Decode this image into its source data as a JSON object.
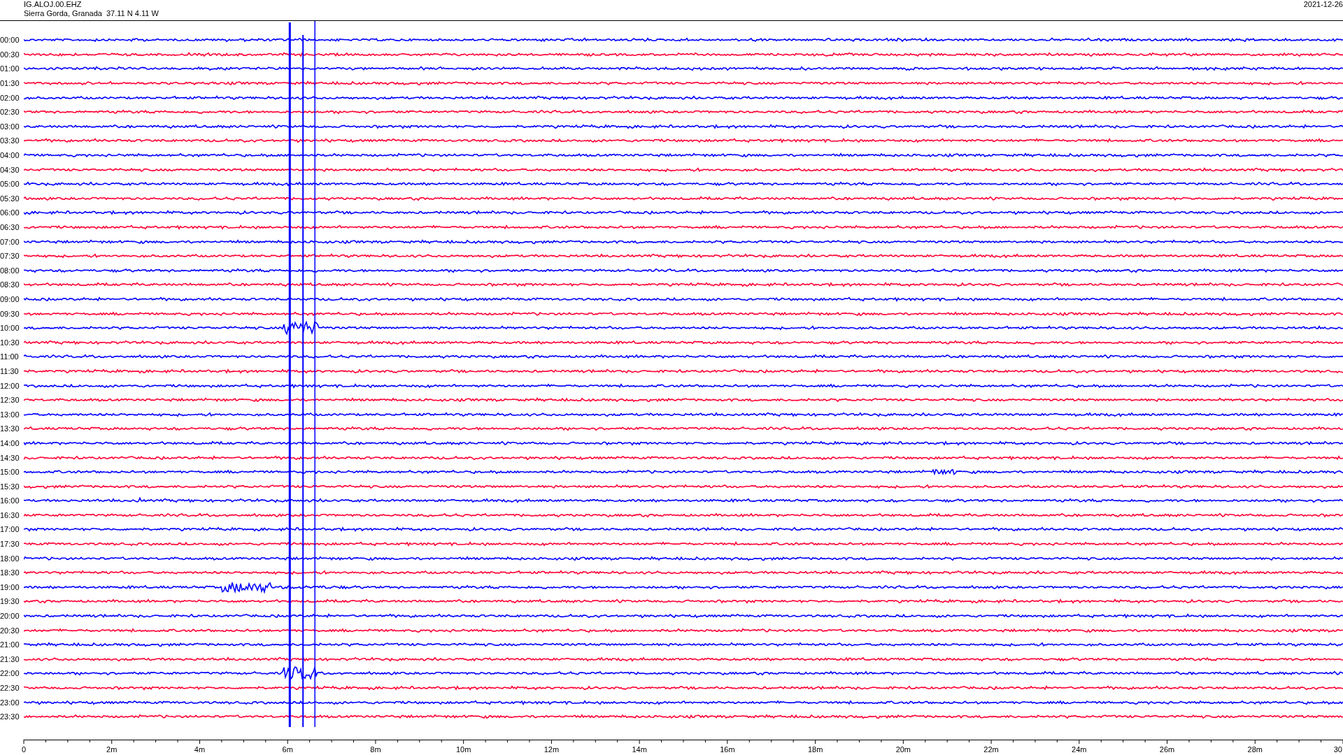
{
  "header": {
    "station": "IG.ALOJ.00.EHZ",
    "location": "Sierra Gorda, Granada  37.11 N 4.11 W",
    "date": "2021-12-26"
  },
  "traces": [
    {
      "time": "00:00",
      "color": "#0000ff"
    },
    {
      "time": "00:30",
      "color": "#ff0033"
    },
    {
      "time": "01:00",
      "color": "#0000ff"
    },
    {
      "time": "01:30",
      "color": "#ff0033"
    },
    {
      "time": "02:00",
      "color": "#0000ff"
    },
    {
      "time": "02:30",
      "color": "#ff0033"
    },
    {
      "time": "03:00",
      "color": "#0000ff"
    },
    {
      "time": "03:30",
      "color": "#ff0033"
    },
    {
      "time": "04:00",
      "color": "#0000ff"
    },
    {
      "time": "04:30",
      "color": "#ff0033"
    },
    {
      "time": "05:00",
      "color": "#0000ff"
    },
    {
      "time": "05:30",
      "color": "#ff0033"
    },
    {
      "time": "06:00",
      "color": "#0000ff"
    },
    {
      "time": "06:30",
      "color": "#ff0033"
    },
    {
      "time": "07:00",
      "color": "#0000ff"
    },
    {
      "time": "07:30",
      "color": "#ff0033"
    },
    {
      "time": "08:00",
      "color": "#0000ff"
    },
    {
      "time": "08:30",
      "color": "#ff0033"
    },
    {
      "time": "09:00",
      "color": "#0000ff"
    },
    {
      "time": "09:30",
      "color": "#ff0033"
    },
    {
      "time": "10:00",
      "color": "#0000ff"
    },
    {
      "time": "10:30",
      "color": "#ff0033"
    },
    {
      "time": "11:00",
      "color": "#0000ff"
    },
    {
      "time": "11:30",
      "color": "#ff0033"
    },
    {
      "time": "12:00",
      "color": "#0000ff"
    },
    {
      "time": "12:30",
      "color": "#ff0033"
    },
    {
      "time": "13:00",
      "color": "#0000ff"
    },
    {
      "time": "13:30",
      "color": "#ff0033"
    },
    {
      "time": "14:00",
      "color": "#0000ff"
    },
    {
      "time": "14:30",
      "color": "#ff0033"
    },
    {
      "time": "15:00",
      "color": "#0000ff"
    },
    {
      "time": "15:30",
      "color": "#ff0033"
    },
    {
      "time": "16:00",
      "color": "#0000ff"
    },
    {
      "time": "16:30",
      "color": "#ff0033"
    },
    {
      "time": "17:00",
      "color": "#0000ff"
    },
    {
      "time": "17:30",
      "color": "#ff0033"
    },
    {
      "time": "18:00",
      "color": "#0000ff"
    },
    {
      "time": "18:30",
      "color": "#ff0033"
    },
    {
      "time": "19:00",
      "color": "#0000ff"
    },
    {
      "time": "19:30",
      "color": "#ff0033"
    },
    {
      "time": "20:00",
      "color": "#0000ff"
    },
    {
      "time": "20:30",
      "color": "#ff0033"
    },
    {
      "time": "21:00",
      "color": "#0000ff"
    },
    {
      "time": "21:30",
      "color": "#ff0033"
    },
    {
      "time": "22:00",
      "color": "#0000ff"
    },
    {
      "time": "22:30",
      "color": "#ff0033"
    },
    {
      "time": "23:00",
      "color": "#0000ff"
    },
    {
      "time": "23:30",
      "color": "#ff0033"
    }
  ],
  "x_axis": {
    "ticks": [
      "0",
      "2m",
      "4m",
      "6m",
      "8m",
      "10m",
      "12m",
      "14m",
      "16m",
      "18m",
      "20m",
      "22m",
      "24m",
      "26m",
      "28m",
      "30"
    ]
  }
}
